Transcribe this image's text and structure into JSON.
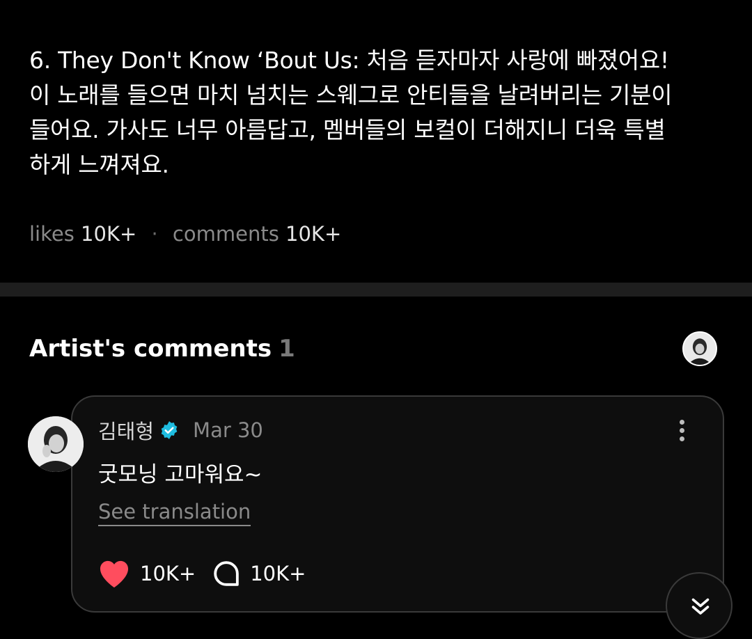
{
  "post": {
    "lines": [
      "6. They Don't Know ‘Bout Us: 처음 듣자마자 사랑에 빠졌어요!",
      "이 노래를 들으면 마치 넘치는 스웨그로 안티들을 날려버리는 기분이",
      "들어요. 가사도 너무 아름답고, 멤버들의 보컬이 더해지니 더욱 특별",
      "하게 느껴져요."
    ],
    "likes_label": "likes",
    "likes_value": "10K+",
    "separator": "·",
    "comments_label": "comments",
    "comments_value": "10K+"
  },
  "artist_comments": {
    "title": "Artist's comments",
    "count": "1"
  },
  "comment": {
    "author": "김태형",
    "date": "Mar 30",
    "text": "굿모닝 고마워요~",
    "translate_label": "See translation",
    "like_count": "10K+",
    "reply_count": "10K+"
  },
  "colors": {
    "background": "#000000",
    "verified_badge": "#1fbde0",
    "heart": "#ff4d5e",
    "muted_text": "#8a8a8a"
  },
  "icons": [
    "verified-badge-icon",
    "more-options-icon",
    "heart-icon",
    "comment-bubble-icon",
    "chevron-double-down-icon"
  ]
}
